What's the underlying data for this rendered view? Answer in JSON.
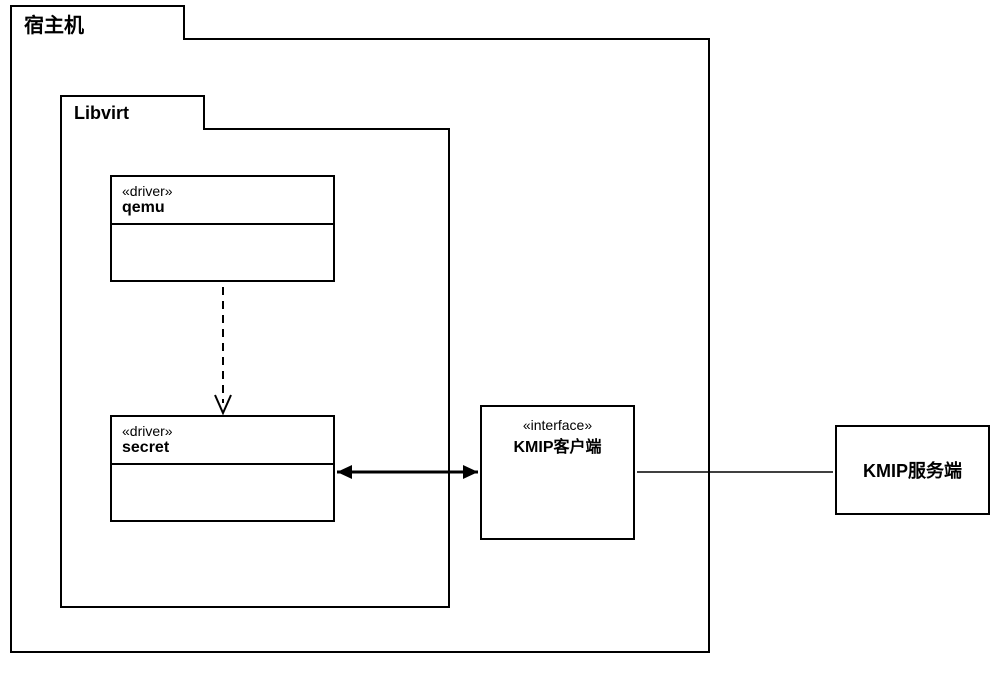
{
  "host": {
    "label": "宿主机"
  },
  "libvirt": {
    "label": "Libvirt"
  },
  "qemu": {
    "stereotype": "«driver»",
    "name": "qemu"
  },
  "secret": {
    "stereotype": "«driver»",
    "name": "secret"
  },
  "kmip_client": {
    "stereotype": "«interface»",
    "name": "KMIP客户端"
  },
  "kmip_server": {
    "name": "KMIP服务端"
  }
}
